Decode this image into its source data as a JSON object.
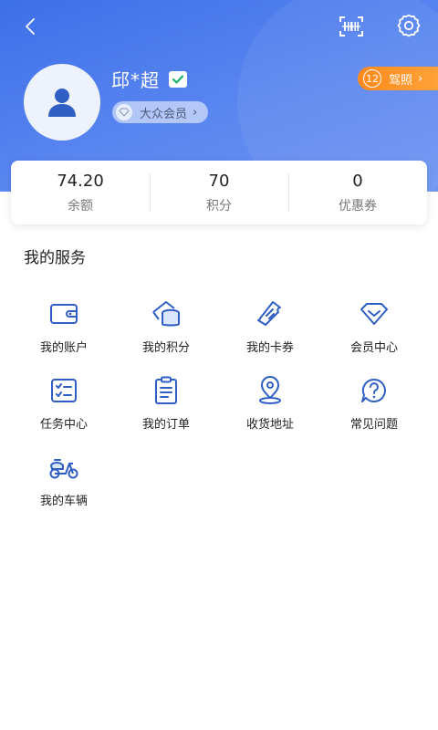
{
  "header": {
    "back_icon": "chevron-left-icon",
    "scan_icon": "scan-icon",
    "settings_icon": "gear-icon"
  },
  "profile": {
    "name": "邱*超",
    "member_label": "大众会员",
    "license_count": "12",
    "license_label": "驾照"
  },
  "stats": [
    {
      "value": "74.20",
      "label": "余额"
    },
    {
      "value": "70",
      "label": "积分"
    },
    {
      "value": "0",
      "label": "优惠券"
    }
  ],
  "services": {
    "title": "我的服务",
    "items": [
      {
        "label": "我的账户",
        "icon": "wallet-icon"
      },
      {
        "label": "我的积分",
        "icon": "coins-icon"
      },
      {
        "label": "我的卡券",
        "icon": "ticket-icon"
      },
      {
        "label": "会员中心",
        "icon": "diamond-icon"
      },
      {
        "label": "任务中心",
        "icon": "task-list-icon"
      },
      {
        "label": "我的订单",
        "icon": "order-icon"
      },
      {
        "label": "收货地址",
        "icon": "location-icon"
      },
      {
        "label": "常见问题",
        "icon": "question-icon"
      },
      {
        "label": "我的车辆",
        "icon": "scooter-icon"
      }
    ]
  },
  "colors": {
    "primary": "#3d6fe8",
    "icon_blue": "#2f5ec4",
    "license_orange": "#ff8a1d",
    "verified_green": "#1fb36b"
  }
}
